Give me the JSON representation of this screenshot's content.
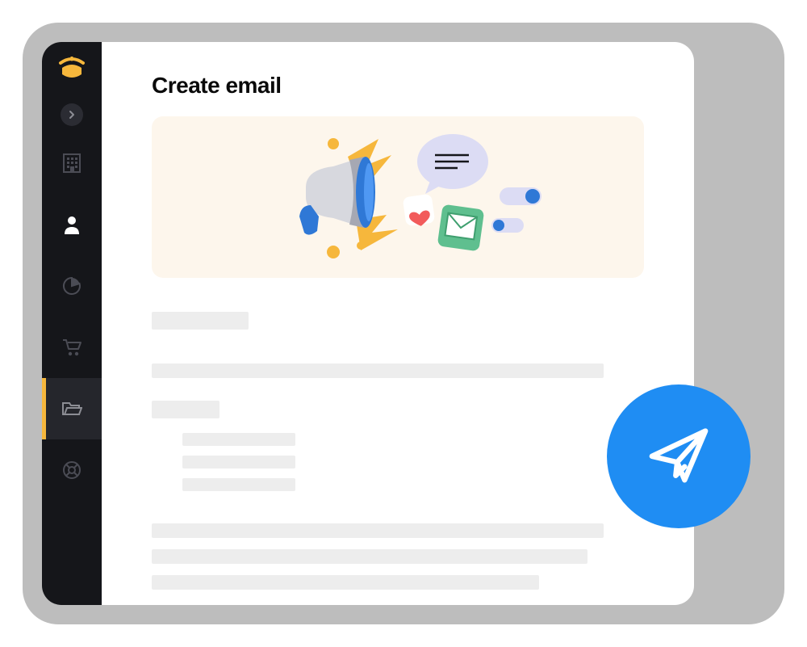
{
  "page": {
    "title": "Create email"
  },
  "sidebar": {
    "logo": "app-logo",
    "items": [
      {
        "icon": "chevron-right-icon",
        "label": "Expand",
        "active": false
      },
      {
        "icon": "building-icon",
        "label": "Company",
        "active": false
      },
      {
        "icon": "user-icon",
        "label": "Contacts",
        "active": false
      },
      {
        "icon": "chart-pie-icon",
        "label": "Reports",
        "active": false
      },
      {
        "icon": "cart-icon",
        "label": "Orders",
        "active": false
      },
      {
        "icon": "folder-open-icon",
        "label": "Campaigns",
        "active": true
      },
      {
        "icon": "lifebuoy-icon",
        "label": "Help",
        "active": false
      }
    ]
  },
  "hero": {
    "illustration": "megaphone-announcement"
  },
  "fab": {
    "icon": "paper-plane-icon",
    "label": "Send"
  },
  "colors": {
    "accent": "#1f8df3",
    "brand": "#f6b73c",
    "sidebar_bg": "#15161a",
    "hero_bg": "#fdf6ec"
  }
}
